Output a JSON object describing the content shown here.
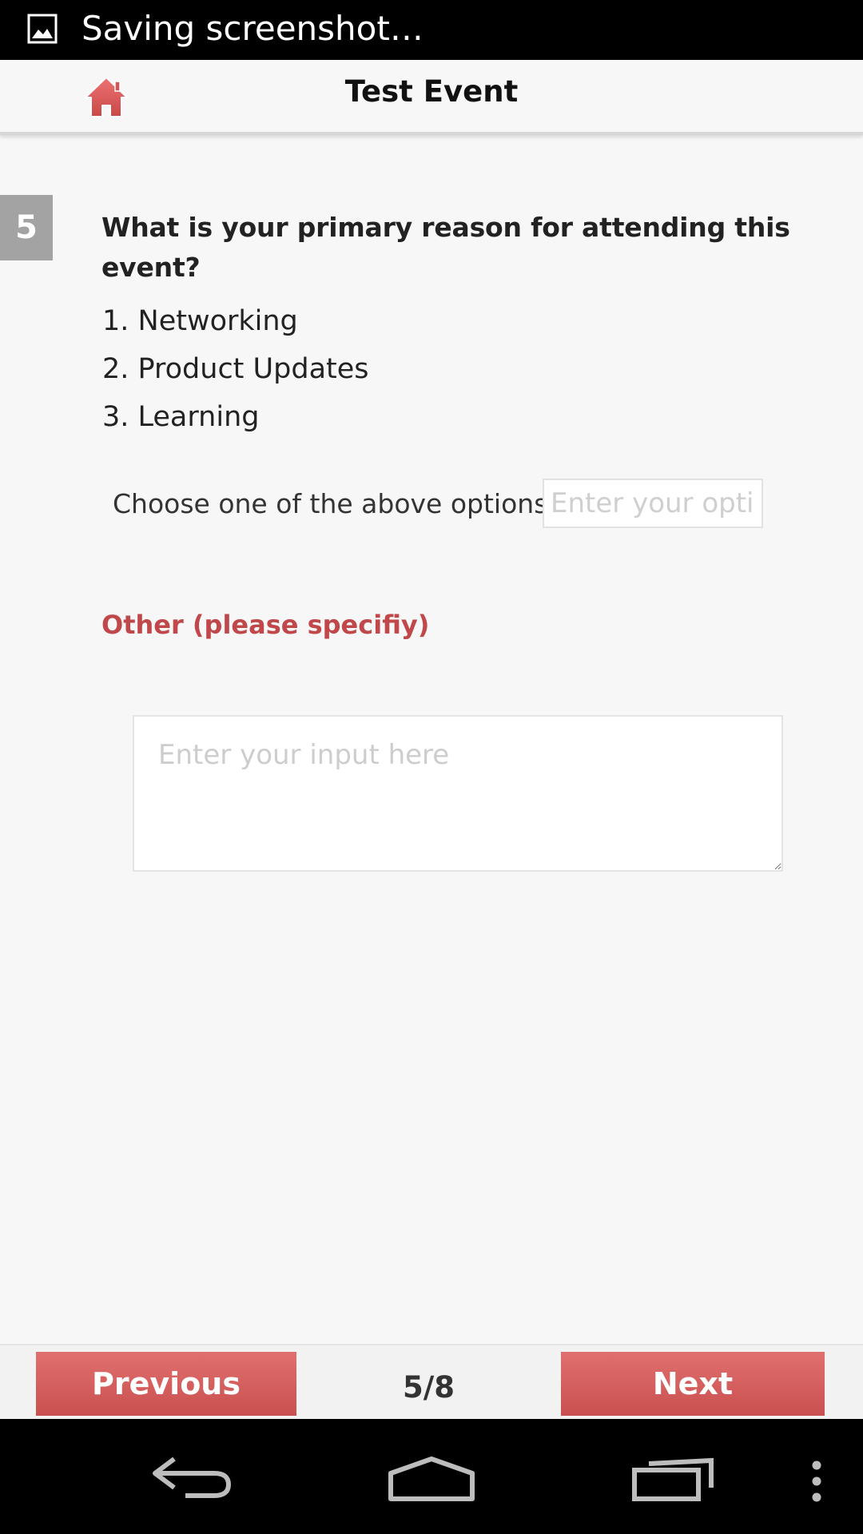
{
  "status_bar": {
    "text": "Saving screenshot…",
    "icon": "image-icon"
  },
  "header": {
    "title": "Test Event",
    "home_icon": "home-icon"
  },
  "question": {
    "number": "5",
    "text": "What is your primary reason for attending this event?",
    "options": [
      "1. Networking",
      "2. Product Updates",
      "3. Learning"
    ],
    "choose_label": "Choose one of the above options",
    "choose_placeholder": "Enter your option",
    "other_label": "Other (please specifiy)",
    "other_placeholder": "Enter your input here"
  },
  "navigation": {
    "previous_label": "Previous",
    "next_label": "Next",
    "page_indicator": "5/8"
  },
  "system_nav": {
    "icons": [
      "back-icon",
      "home-outline-icon",
      "recent-apps-icon",
      "overflow-menu-icon"
    ]
  },
  "colors": {
    "accent": "#d9605f",
    "other_label": "#c0474a",
    "badge": "#a3a3a3"
  }
}
